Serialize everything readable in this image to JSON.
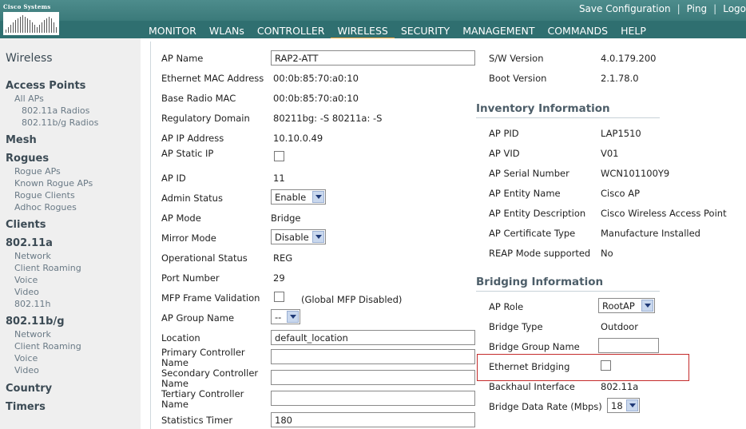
{
  "header": {
    "logo_text": "Cisco Systems",
    "util_links": [
      "Save Configuration",
      "Ping",
      "Logo"
    ],
    "util_sep": "|",
    "nav": [
      "MONITOR",
      "WLANs",
      "CONTROLLER",
      "WIRELESS",
      "SECURITY",
      "MANAGEMENT",
      "COMMANDS",
      "HELP"
    ],
    "active_nav": "WIRELESS",
    "accent_color": "#f3a53a",
    "bar_color": "#3f7f80"
  },
  "sidebar": {
    "title": "Wireless",
    "access_points": "Access Points",
    "all_aps": "All APs",
    "radio_a": "802.11a Radios",
    "radio_bg": "802.11b/g Radios",
    "mesh": "Mesh",
    "rogues": "Rogues",
    "rogue_aps": "Rogue APs",
    "known_rogue_aps": "Known Rogue APs",
    "rogue_clients": "Rogue Clients",
    "adhoc_rogues": "Adhoc Rogues",
    "clients": "Clients",
    "a": "802.11a",
    "a_network": "Network",
    "a_client_roaming": "Client Roaming",
    "a_voice": "Voice",
    "a_video": "Video",
    "a_h": "802.11h",
    "bg": "802.11b/g",
    "bg_network": "Network",
    "bg_client_roaming": "Client Roaming",
    "bg_voice": "Voice",
    "bg_video": "Video",
    "country": "Country",
    "timers": "Timers"
  },
  "form": {
    "ap_name_label": "AP Name",
    "ap_name": "RAP2-ATT",
    "eth_mac_label": "Ethernet MAC Address",
    "eth_mac": "00:0b:85:70:a0:10",
    "radio_mac_label": "Base Radio MAC",
    "radio_mac": "00:0b:85:70:a0:10",
    "reg_domain_label": "Regulatory Domain",
    "reg_domain": "80211bg: -S 80211a: -S",
    "ap_ip_label": "AP IP Address",
    "ap_ip": "10.10.0.49",
    "static_ip_label": "AP Static IP",
    "ap_id_label": "AP ID",
    "ap_id": "11",
    "admin_status_label": "Admin Status",
    "admin_status": "Enable",
    "ap_mode_label": "AP Mode",
    "ap_mode": "Bridge",
    "mirror_mode_label": "Mirror Mode",
    "mirror_mode": "Disable",
    "op_status_label": "Operational Status",
    "op_status": "REG",
    "port_number_label": "Port Number",
    "port_number": "29",
    "mfp_label": "MFP Frame Validation",
    "mfp_note": "(Global MFP Disabled)",
    "group_name_label": "AP Group Name",
    "group_name": "--",
    "location_label": "Location",
    "location": "default_location",
    "primary_label": "Primary Controller Name",
    "secondary_label": "Secondary Controller Name",
    "tertiary_label": "Tertiary Controller Name",
    "stats_timer_label": "Statistics Timer",
    "stats_timer": "180"
  },
  "versions": {
    "sw_label": "S/W Version",
    "sw": "4.0.179.200",
    "boot_label": "Boot Version",
    "boot": "2.1.78.0"
  },
  "inventory": {
    "heading": "Inventory Information",
    "pid_label": "AP PID",
    "pid": "LAP1510",
    "vid_label": "AP VID",
    "vid": "V01",
    "serial_label": "AP Serial Number",
    "serial": "WCN101100Y9",
    "entity_name_label": "AP Entity Name",
    "entity_name": "Cisco AP",
    "entity_desc_label": "AP Entity Description",
    "entity_desc": "Cisco Wireless Access Point",
    "cert_label": "AP Certificate Type",
    "cert": "Manufacture Installed",
    "reap_label": "REAP Mode supported",
    "reap": "No"
  },
  "bridging": {
    "heading": "Bridging Information",
    "role_label": "AP Role",
    "role": "RootAP",
    "type_label": "Bridge Type",
    "type": "Outdoor",
    "group_label": "Bridge Group Name",
    "eth_bridging_label": "Ethernet Bridging",
    "backhaul_label": "Backhaul Interface",
    "backhaul": "802.11a",
    "rate_label": "Bridge Data Rate (Mbps)",
    "rate": "18"
  }
}
